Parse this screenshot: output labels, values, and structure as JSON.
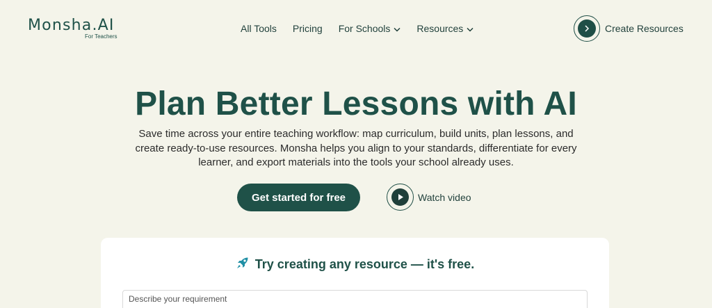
{
  "header": {
    "logo_main": "Monsha.AI",
    "logo_sub": "For Teachers",
    "nav": [
      {
        "label": "All Tools"
      },
      {
        "label": "Pricing"
      },
      {
        "label": "For Schools"
      },
      {
        "label": "Resources"
      }
    ],
    "cta_label": "Create Resources"
  },
  "hero": {
    "title": "Plan Better Lessons with AI",
    "description": "Save time across your entire teaching workflow: map curriculum, build units, plan lessons, and create ready-to-use resources. Monsha helps you align to your standards, differentiate for every learner, and export materials into the tools your school already uses.",
    "primary_button": "Get started for free",
    "watch_label": "Watch video"
  },
  "card": {
    "title": "Try creating any resource — it's free.",
    "input_placeholder": "Describe your requirement"
  },
  "colors": {
    "background": "#f4f4ea",
    "brand": "#1f5148",
    "accent_icon": "#1f8fa5"
  },
  "icons": {
    "cta": "chevron-right-icon",
    "watch": "play-icon",
    "card": "rocket-icon"
  }
}
